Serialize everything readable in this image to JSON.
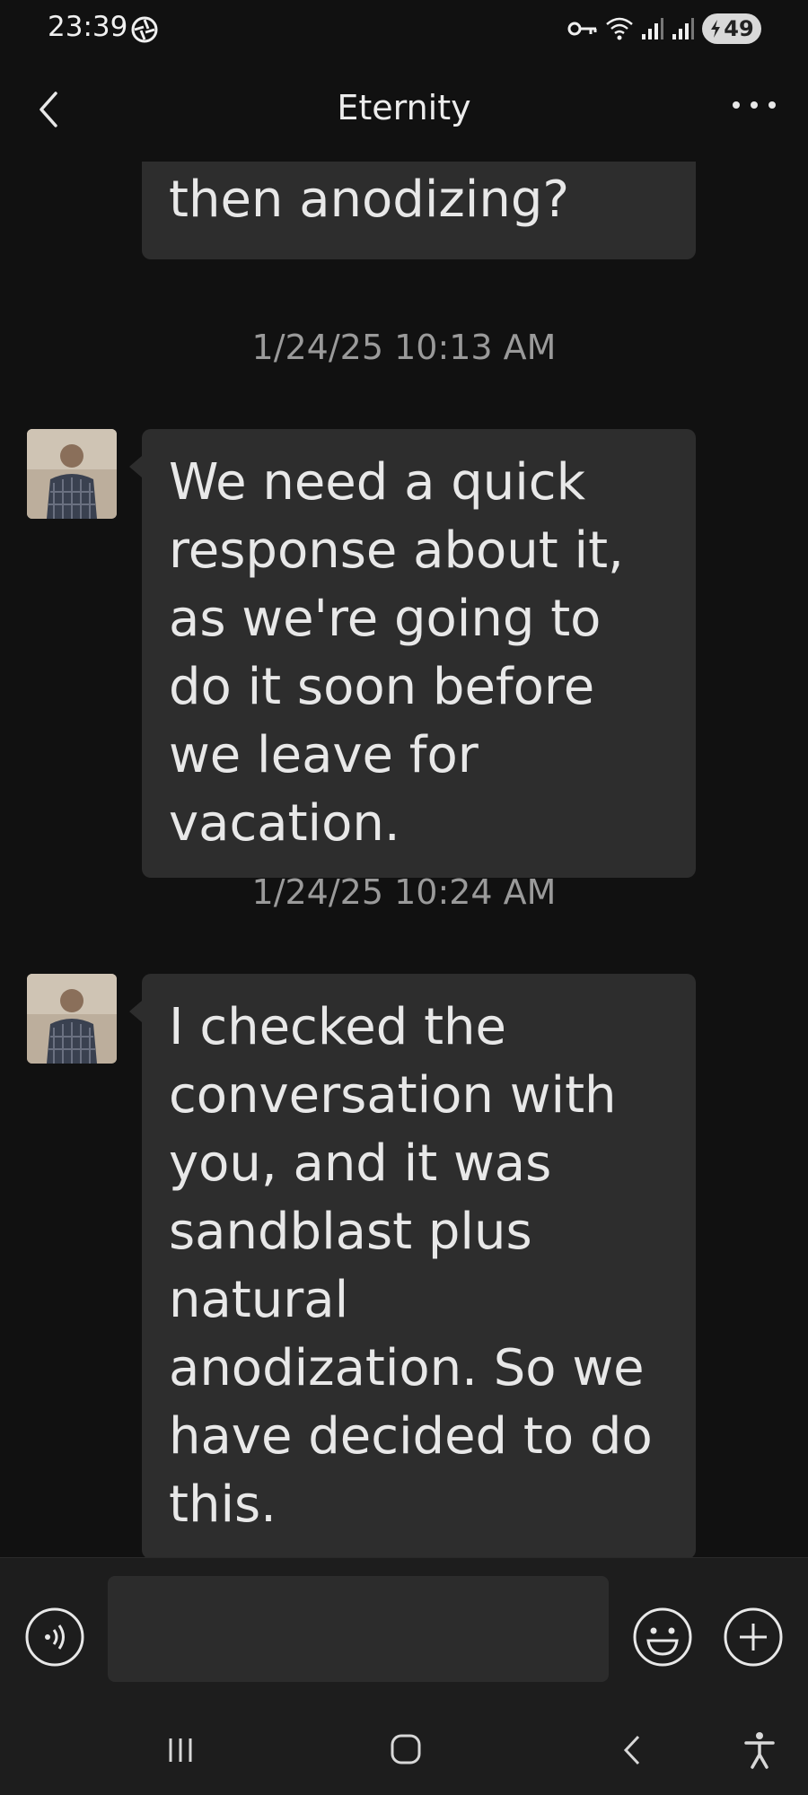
{
  "status_bar": {
    "time": "23:39",
    "battery_level": "49",
    "icons": [
      "aperture-icon",
      "key-icon",
      "wifi-icon",
      "signal-icon",
      "signal-icon",
      "battery-charging-icon"
    ]
  },
  "header": {
    "title": "Eternity",
    "back_icon": "chevron-left-icon",
    "more_icon": "more-dots-icon"
  },
  "messages": [
    {
      "timestamp": "",
      "text": "then anodizing?"
    },
    {
      "timestamp": "1/24/25 10:13 AM",
      "text": "We need a quick response about it, as we're going to do it soon before we leave for vacation."
    },
    {
      "timestamp": "1/24/25 10:24 AM",
      "text": "I checked the conversation with you, and it was sandblast plus natural anodization. So we have decided to do this."
    }
  ],
  "composer": {
    "input_value": "",
    "placeholder": "",
    "voice_icon": "voice-icon",
    "emoji_icon": "emoji-icon",
    "add_icon": "plus-icon"
  },
  "navigation": {
    "items": [
      "recent-apps-icon",
      "home-icon",
      "back-icon",
      "accessibility-icon"
    ]
  },
  "colors": {
    "background": "#111111",
    "bubble": "#2d2d2d",
    "bar": "#1d1d1d",
    "text": "#e8e8e8",
    "timestamp": "#9a9a9a"
  }
}
